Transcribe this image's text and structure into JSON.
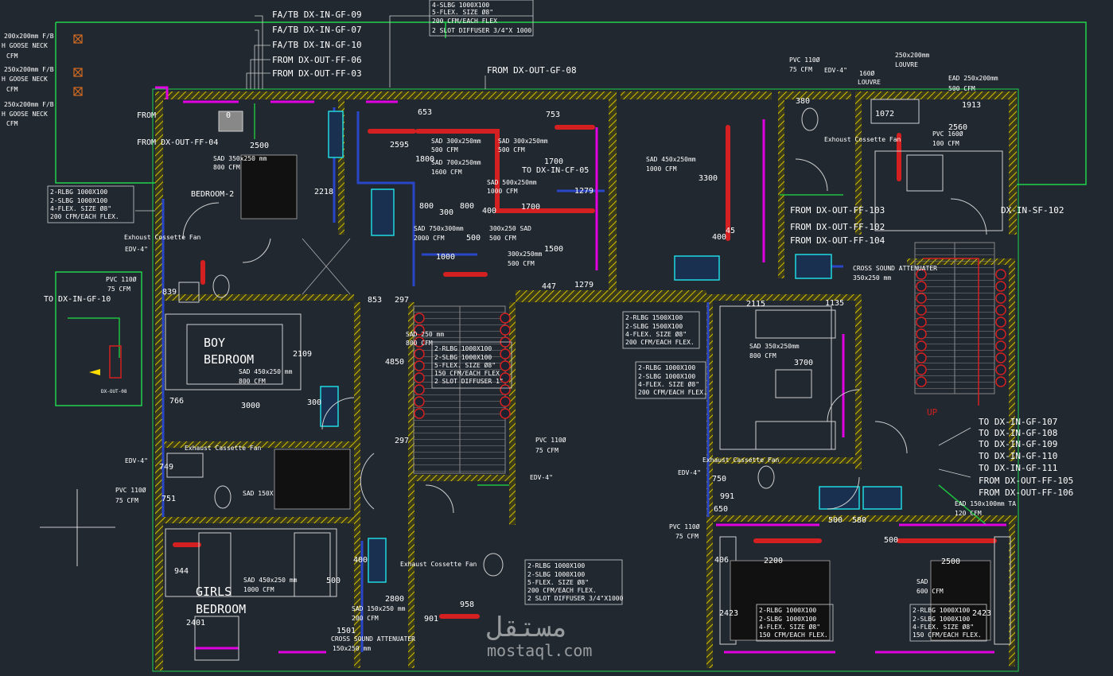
{
  "colors": {
    "background": "#212830",
    "wall": "#c8c8c8",
    "hatch": "#d4c000",
    "supply_duct": "#d42020",
    "return_duct": "#2a46c8",
    "fresh_air": "#1fbf40",
    "outline": "#1fd24a",
    "magenta": "#e000e0",
    "text": "#ffffff",
    "cyan": "#20d8e0"
  },
  "callouts_top": [
    "FA/TB DX-IN-GF-09",
    "FA/TB DX-IN-GF-07",
    "FA/TB DX-IN-GF-10",
    "FROM DX-OUT-FF-06",
    "FROM DX-OUT-FF-03",
    "FROM DX-OUT-GF-08"
  ],
  "left_notes": [
    "200x200mm F/B",
    "H GOOSE NECK",
    "CFM",
    "250x200mm F/B",
    "H GOOSE NECK",
    "CFM",
    "250x200mm F/B",
    "H GOOSE NECK",
    "CFM"
  ],
  "top_box": [
    "4-SLBG 1000X100",
    "5-FLEX. SIZE Ø8\"",
    "200 CFM/EACH FLEX",
    "2 SLOT DIFFUSER 3/4\"X 1000"
  ],
  "rooms": {
    "bedroom2": "BEDROOM-2",
    "boy1": "BOY",
    "boy2": "BEDROOM",
    "girls1": "GIRLS",
    "girls2": "BEDROOM"
  },
  "boxes": {
    "b1": [
      "2-RLBG 1000X100",
      "2-SLBG 1000X100",
      "4-FLEX. SIZE Ø8\"",
      "200 CFM/EACH FLEX."
    ],
    "b2": [
      "2-RLBG 1500X100",
      "2-SLBG 1500X100",
      "4-FLEX. SIZE Ø8\"",
      "200 CFM/EACH FLEX."
    ],
    "b3": [
      "2-RLBG 1000X100",
      "2-SLBG 1000X100",
      "4-FLEX. SIZE Ø8\"",
      "200 CFM/EACH FLEX."
    ],
    "b4": [
      "2-RLBG 1000X100",
      "2-SLBG 1000X100",
      "5-FLEX. SIZE Ø8\"",
      "150 CFM/EACH FLEX",
      "2 SLOT DIFFUSER 1\""
    ],
    "b5": [
      "2-RLBG 1000X100",
      "2-SLBG 1000X100",
      "5-FLEX. SIZE Ø8\"",
      "200 CFM/EACH FLEX.",
      "2 SLOT DIFFUSER 3/4\"X1000"
    ],
    "b6": [
      "2-RLBG 1000X100",
      "2-SLBG 1000X100",
      "4-FLEX. SIZE Ø8\"",
      "150 CFM/EACH FLEX."
    ],
    "b7": [
      "2-RLBG 1000X100",
      "2-SLBG 1000X100",
      "4-FLEX. SIZE Ø8\"",
      "150 CFM/EACH FLEX."
    ]
  },
  "right_callouts": [
    "TO DX-IN-GF-107",
    "TO DX-IN-GF-108",
    "TO DX-IN-GF-109",
    "TO DX-IN-GF-110",
    "TO DX-IN-GF-111",
    "FROM DX-OUT-FF-105",
    "FROM DX-OUT-FF-106"
  ],
  "mid_callouts": [
    "FROM DX-OUT-FF-103",
    "FROM DX-OUT-FF-102",
    "FROM DX-OUT-FF-104",
    "DX-IN-SF-102"
  ],
  "labels": {
    "from_short": "FROM",
    "from_ff04": "FROM DX-OUT-FF-04",
    "to_gf10": "TO DX-IN-GF-10",
    "to_gf05": "TO DX-IN-CF-05",
    "dx_out_08": "DX-OUT-08",
    "sad1": "SAD 350x250 mm",
    "sad1b": "800 CFM",
    "sad2": "SAD 300x250mm",
    "sad2b": "500 CFM",
    "sad3": "SAD 300x250mm",
    "sad3b": "500 CFM",
    "sad4": "SAD 700x250mm",
    "sad4b": "1600 CFM",
    "sad5": "SAD 500x250mm",
    "sad5b": "1000 CFM",
    "sad6": "SAD 450x250mm",
    "sad6b": "1000 CFM",
    "sad7": "SAD 750x300mm",
    "sad7b": "2000 CFM",
    "sad8": "300x250 SAD",
    "sad8b": "500 CFM",
    "sad9": "300x250mm",
    "sad9b": "500 CFM",
    "sad10": "SAD 350x250mm",
    "sad10b": "800 CFM",
    "sad11": "SAD 250 mm",
    "sad11b": "800 CFM",
    "sad12": "SAD 450x250 mm",
    "sad12b": "1000 CFM",
    "sad13": "SAD",
    "sad13b": "600 CFM",
    "sad14": "SAD 150x250 mm",
    "sad14b": "200 CFM",
    "sad15": "SAD 150X",
    "exhaust1": "Exhoust Cossette Fan",
    "exhaust2": "Exhaust Cassette Fan",
    "exhaust3": "Exhaust Cossette Fan",
    "exhaust4": "Exhoust Cossette Fan",
    "exhaust5": "Exhaust Cassette Fan",
    "edv1": "EDV-4\"",
    "edv2": "EDV-4\"",
    "edv3": "EDV-4\"",
    "edv4": "EDV-4\"",
    "edv5": "EDV-4\"",
    "pvc1": "PVC 110Ø",
    "pvc1b": "75 CFM",
    "pvc2": "PVC 110Ø",
    "pvc2b": "75 CFM",
    "pvc3": "PVC 110Ø",
    "pvc3b": "75 CFM",
    "pvc4": "PVC 110Ø",
    "pvc4b": "75 CFM",
    "pvc5": "PVC 110Ø",
    "pvc5b": "75 CFM",
    "pvc6": "PVC 160Ø",
    "pvc6b": "100 CFM",
    "louvre1": "250x200mm",
    "louvre1b": "LOUVRE",
    "louvre2": "160Ø",
    "louvre2b": "LOUVRE",
    "ead1": "EAD 250x200mm",
    "ead1b": "500 CFM",
    "ead2": "EAD 150x100mm TA",
    "ead2b": "120 CFM",
    "csa1": "CROSS SOUND ATTENUATER",
    "csa1b": "350x250 mm",
    "csa2": "CROSS SOUND ATTENUATER",
    "csa2b": "150x250 mm",
    "up": "UP",
    "watermark1": "مستقل",
    "watermark2": "mostaql.com"
  },
  "dims": [
    "2500",
    "2218",
    "2595",
    "653",
    "753",
    "1800",
    "1700",
    "800",
    "300",
    "800",
    "1700",
    "1279",
    "1000",
    "500",
    "400",
    "3300",
    "400",
    "45",
    "1500",
    "447",
    "1279",
    "853",
    "297",
    "4850",
    "297",
    "2109",
    "3000",
    "766",
    "300",
    "839",
    "749",
    "751",
    "944",
    "400",
    "500",
    "2800",
    "2401",
    "1501",
    "901",
    "958",
    "3700",
    "2115",
    "1135",
    "750",
    "991",
    "650",
    "500",
    "580",
    "500",
    "2200",
    "2500",
    "406",
    "2423",
    "2423",
    "1913",
    "2560",
    "1072",
    "380",
    "0"
  ]
}
